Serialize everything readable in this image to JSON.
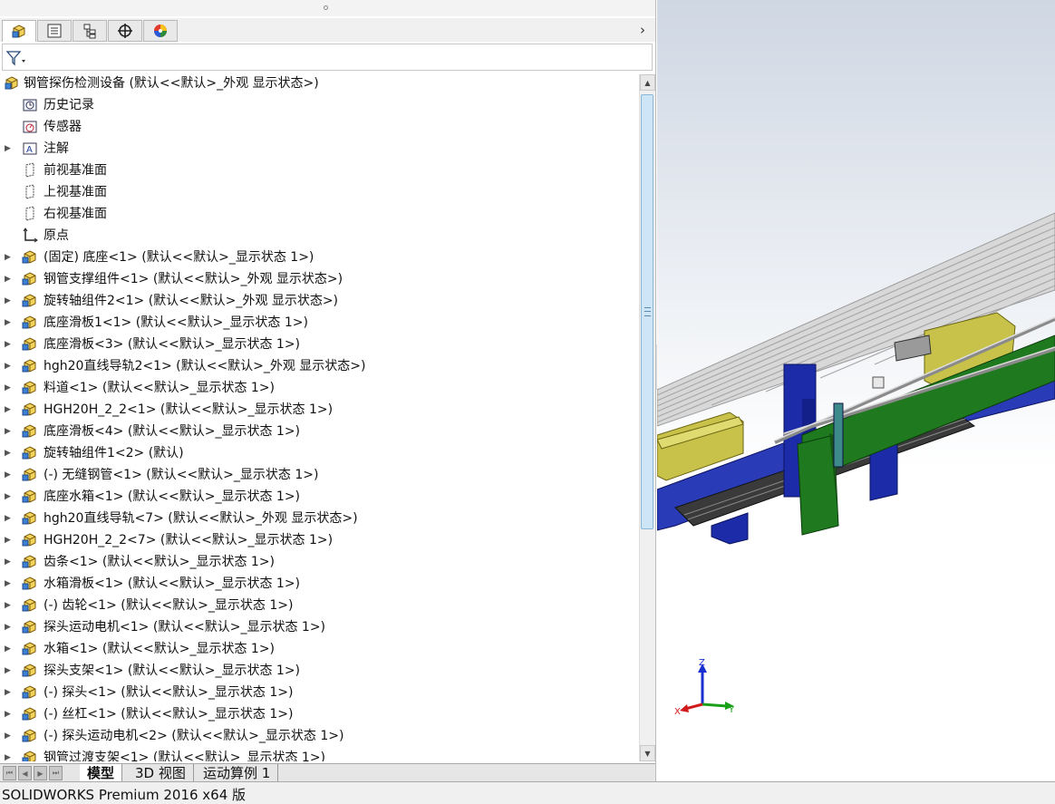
{
  "window": {
    "status_text": "SOLIDWORKS Premium 2016 x64 版"
  },
  "manager_tabs": [
    {
      "name": "featuremanager-tab",
      "icon": "assembly-icon",
      "active": true
    },
    {
      "name": "propertymanager-tab",
      "icon": "property-list-icon",
      "active": false
    },
    {
      "name": "configurationmanager-tab",
      "icon": "configuration-icon",
      "active": false
    },
    {
      "name": "dimxpert-tab",
      "icon": "crosshair-icon",
      "active": false
    },
    {
      "name": "display-manager-tab",
      "icon": "appearance-sphere-icon",
      "active": false
    }
  ],
  "tree": {
    "root": {
      "label": "钢管探伤检测设备  (默认<<默认>_外观 显示状态>)"
    },
    "items": [
      {
        "label": "历史记录",
        "icon": "history-icon",
        "expandable": false
      },
      {
        "label": "传感器",
        "icon": "sensor-icon",
        "expandable": false
      },
      {
        "label": "注解",
        "icon": "annotation-icon",
        "expandable": true
      },
      {
        "label": "前视基准面",
        "icon": "plane-icon",
        "expandable": false
      },
      {
        "label": "上视基准面",
        "icon": "plane-icon",
        "expandable": false
      },
      {
        "label": "右视基准面",
        "icon": "plane-icon",
        "expandable": false
      },
      {
        "label": "原点",
        "icon": "origin-icon",
        "expandable": false
      },
      {
        "label": "(固定) 底座<1> (默认<<默认>_显示状态 1>)",
        "icon": "part-icon",
        "expandable": true
      },
      {
        "label": "钢管支撑组件<1> (默认<<默认>_外观 显示状态>)",
        "icon": "part-icon",
        "expandable": true
      },
      {
        "label": "旋转轴组件2<1> (默认<<默认>_外观 显示状态>)",
        "icon": "part-icon",
        "expandable": true
      },
      {
        "label": "底座滑板1<1> (默认<<默认>_显示状态 1>)",
        "icon": "part-icon",
        "expandable": true
      },
      {
        "label": "底座滑板<3> (默认<<默认>_显示状态 1>)",
        "icon": "part-icon",
        "expandable": true
      },
      {
        "label": "hgh20直线导轨2<1> (默认<<默认>_外观 显示状态>)",
        "icon": "part-icon",
        "expandable": true
      },
      {
        "label": "料道<1> (默认<<默认>_显示状态 1>)",
        "icon": "part-icon",
        "expandable": true
      },
      {
        "label": "HGH20H_2_2<1> (默认<<默认>_显示状态 1>)",
        "icon": "part-icon",
        "expandable": true
      },
      {
        "label": "底座滑板<4> (默认<<默认>_显示状态 1>)",
        "icon": "part-icon",
        "expandable": true
      },
      {
        "label": "旋转轴组件1<2> (默认)",
        "icon": "part-icon",
        "expandable": true
      },
      {
        "label": "(-) 无缝钢管<1> (默认<<默认>_显示状态 1>)",
        "icon": "part-icon",
        "expandable": true
      },
      {
        "label": "底座水箱<1> (默认<<默认>_显示状态 1>)",
        "icon": "part-icon",
        "expandable": true
      },
      {
        "label": "hgh20直线导轨<7> (默认<<默认>_外观 显示状态>)",
        "icon": "part-icon",
        "expandable": true
      },
      {
        "label": "HGH20H_2_2<7> (默认<<默认>_显示状态 1>)",
        "icon": "part-icon",
        "expandable": true
      },
      {
        "label": "齿条<1> (默认<<默认>_显示状态 1>)",
        "icon": "part-icon",
        "expandable": true
      },
      {
        "label": "水箱滑板<1> (默认<<默认>_显示状态 1>)",
        "icon": "part-icon",
        "expandable": true
      },
      {
        "label": "(-) 齿轮<1> (默认<<默认>_显示状态 1>)",
        "icon": "part-icon",
        "expandable": true
      },
      {
        "label": "探头运动电机<1> (默认<<默认>_显示状态 1>)",
        "icon": "part-icon",
        "expandable": true
      },
      {
        "label": "水箱<1> (默认<<默认>_显示状态 1>)",
        "icon": "part-icon",
        "expandable": true
      },
      {
        "label": "探头支架<1> (默认<<默认>_显示状态 1>)",
        "icon": "part-icon",
        "expandable": true
      },
      {
        "label": "(-) 探头<1> (默认<<默认>_显示状态 1>)",
        "icon": "part-icon",
        "expandable": true
      },
      {
        "label": "(-) 丝杠<1> (默认<<默认>_显示状态 1>)",
        "icon": "part-icon",
        "expandable": true
      },
      {
        "label": "(-) 探头运动电机<2> (默认<<默认>_显示状态 1>)",
        "icon": "part-icon",
        "expandable": true
      },
      {
        "label": "钢管过渡支架<1> (默认<<默认>_显示状态 1>)",
        "icon": "part-icon",
        "expandable": true
      }
    ]
  },
  "bottom_tabs": [
    {
      "label": "模型",
      "active": true
    },
    {
      "label": "3D 视图",
      "active": false
    },
    {
      "label": "运动算例 1",
      "active": false
    }
  ],
  "triad": {
    "x": "X",
    "y": "Y",
    "z": "Z"
  },
  "colors": {
    "frame_blue": "#1c2ca8",
    "frame_green": "#1f7a1f",
    "frame_yellow": "#c8c24a",
    "rail_grey": "#bfbfbf"
  }
}
